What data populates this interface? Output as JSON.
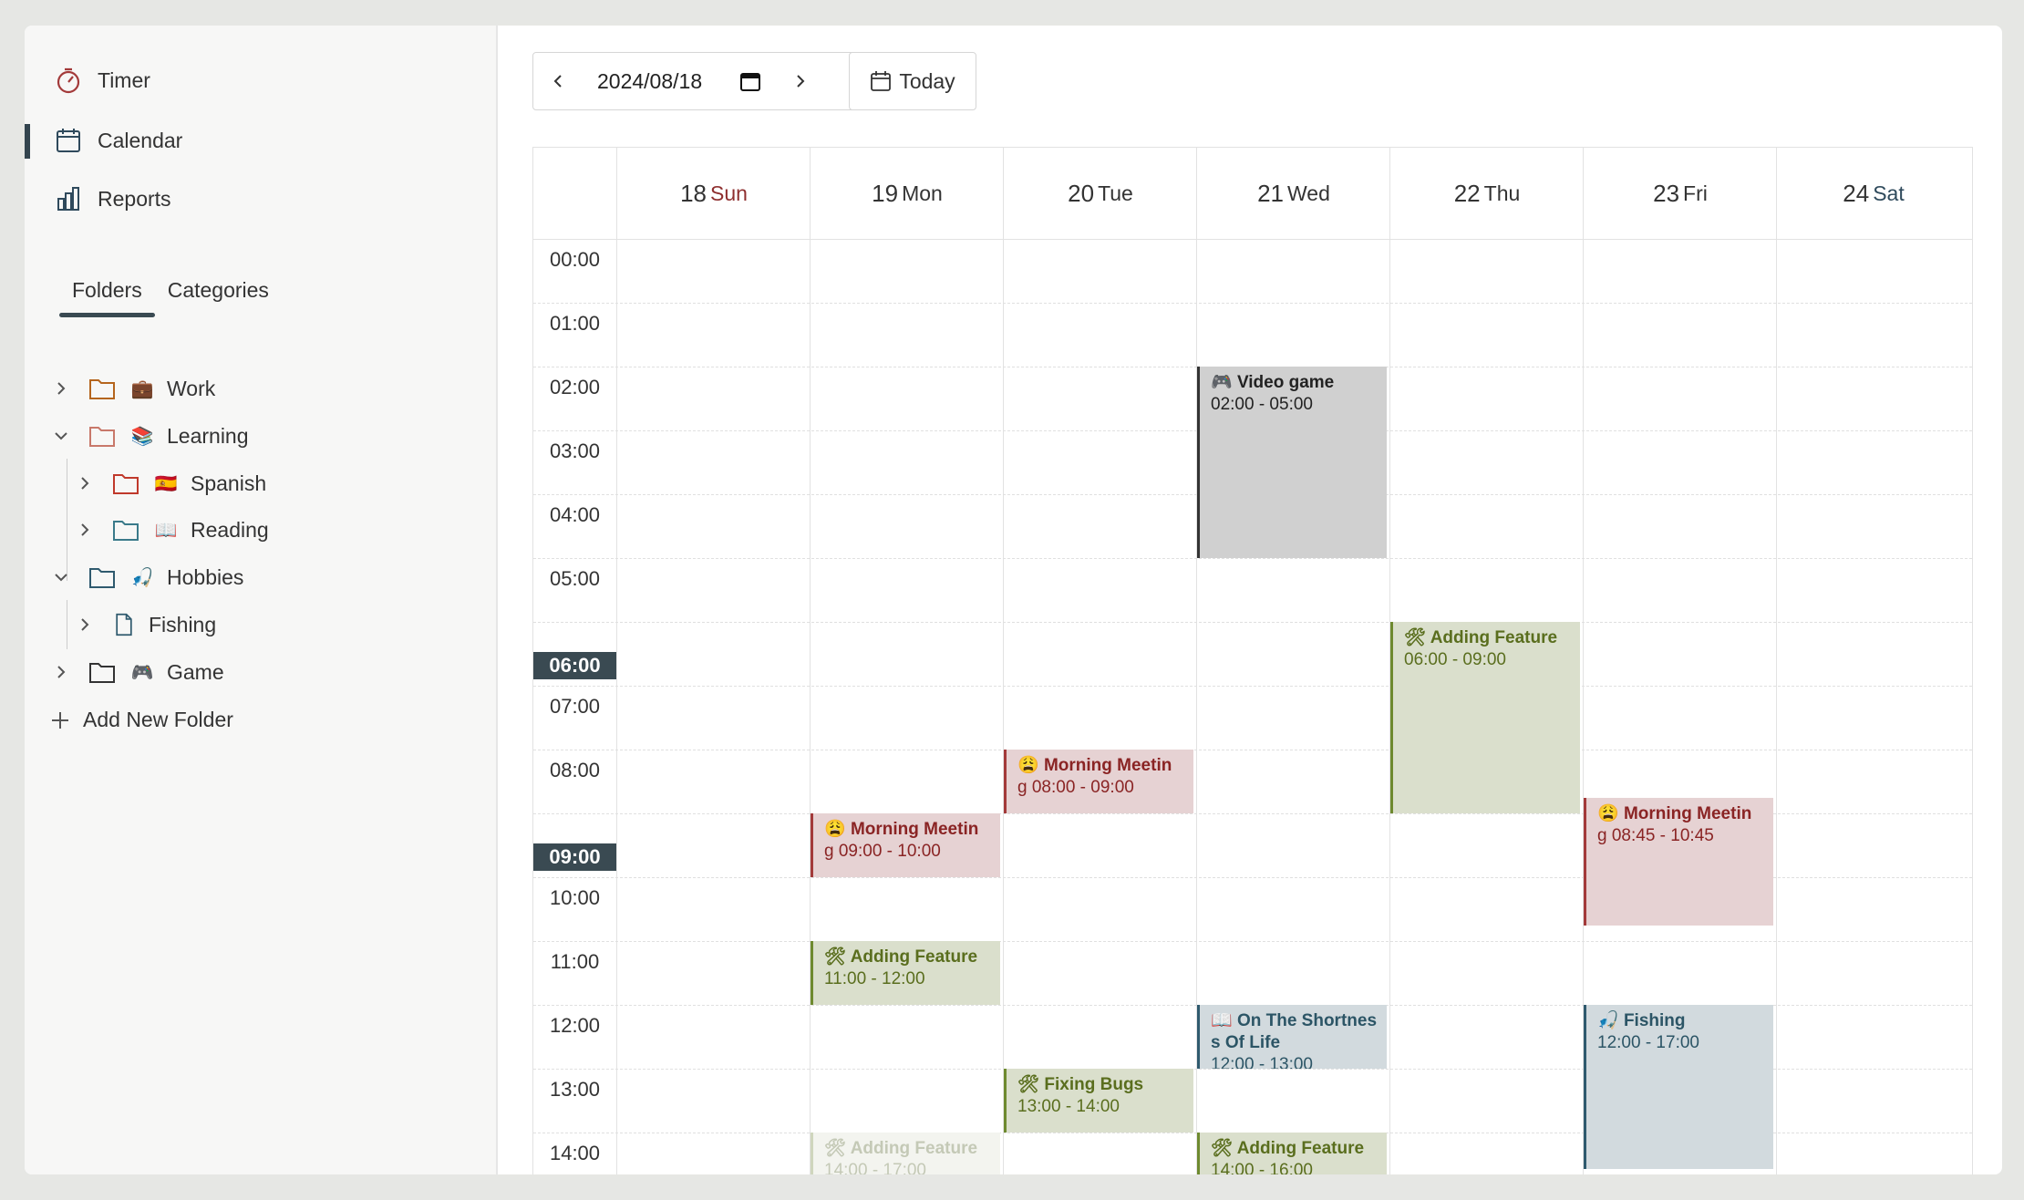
{
  "nav": {
    "timer": "Timer",
    "calendar": "Calendar",
    "reports": "Reports"
  },
  "tabs": {
    "folders": "Folders",
    "categories": "Categories"
  },
  "tree": [
    {
      "emoji": "💼",
      "label": "Work",
      "expanded": false,
      "color": "#b5651d"
    },
    {
      "emoji": "📚",
      "label": "Learning",
      "expanded": true,
      "color": "#c8786a"
    },
    {
      "emoji": "🇪🇸",
      "label": "Spanish",
      "expanded": false,
      "color": "#c0392b"
    },
    {
      "emoji": "📖",
      "label": "Reading",
      "expanded": false,
      "color": "#3a7a8a"
    },
    {
      "emoji": "🎣",
      "label": "Hobbies",
      "expanded": true,
      "color": "#2f5a6e"
    },
    {
      "emoji": "",
      "label": "Fishing",
      "expanded": false,
      "color": "#2f5a6e"
    },
    {
      "emoji": "🎮",
      "label": "Game",
      "expanded": false,
      "color": "#333333"
    }
  ],
  "add_folder": "Add New Folder",
  "toolbar": {
    "date": "2024/08/18",
    "today": "Today"
  },
  "days": [
    {
      "num": "18",
      "name": "Sun"
    },
    {
      "num": "19",
      "name": "Mon"
    },
    {
      "num": "20",
      "name": "Tue"
    },
    {
      "num": "21",
      "name": "Wed"
    },
    {
      "num": "22",
      "name": "Thu"
    },
    {
      "num": "23",
      "name": "Fri"
    },
    {
      "num": "24",
      "name": "Sat"
    }
  ],
  "hours": [
    "00:00",
    "01:00",
    "02:00",
    "03:00",
    "04:00",
    "05:00",
    "06:00",
    "07:00",
    "08:00",
    "09:00",
    "10:00",
    "11:00",
    "12:00",
    "13:00",
    "14:00"
  ],
  "events": [
    {
      "icon": "🎮",
      "title": "Video game",
      "time": "02:00 - 05:00"
    },
    {
      "icon": "🛠",
      "title": "Adding Feature",
      "time": "06:00 - 09:00"
    },
    {
      "icon": "😩",
      "title": "Morning Meetin",
      "title2": "g",
      "time": "08:00 - 09:00"
    },
    {
      "icon": "😩",
      "title": "Morning Meetin",
      "title2": "g",
      "time": "09:00 - 10:00"
    },
    {
      "icon": "😩",
      "title": "Morning Meetin",
      "title2": "g",
      "time": "08:45 - 10:45"
    },
    {
      "icon": "🛠",
      "title": "Adding Feature",
      "time": "11:00 - 12:00"
    },
    {
      "icon": "📖",
      "title": "On The Shortnes",
      "title2": "s Of Life",
      "time": "12:00 - 13:00"
    },
    {
      "icon": "🎣",
      "title": "Fishing",
      "time": "12:00 - 17:00"
    },
    {
      "icon": "🛠",
      "title": "Fixing Bugs",
      "time": "13:00 - 14:00"
    },
    {
      "icon": "🛠",
      "title": "Adding Feature",
      "time": "14:00 - 17:00"
    },
    {
      "icon": "🛠",
      "title": "Adding Feature",
      "time": "14:00 - 16:00"
    }
  ]
}
